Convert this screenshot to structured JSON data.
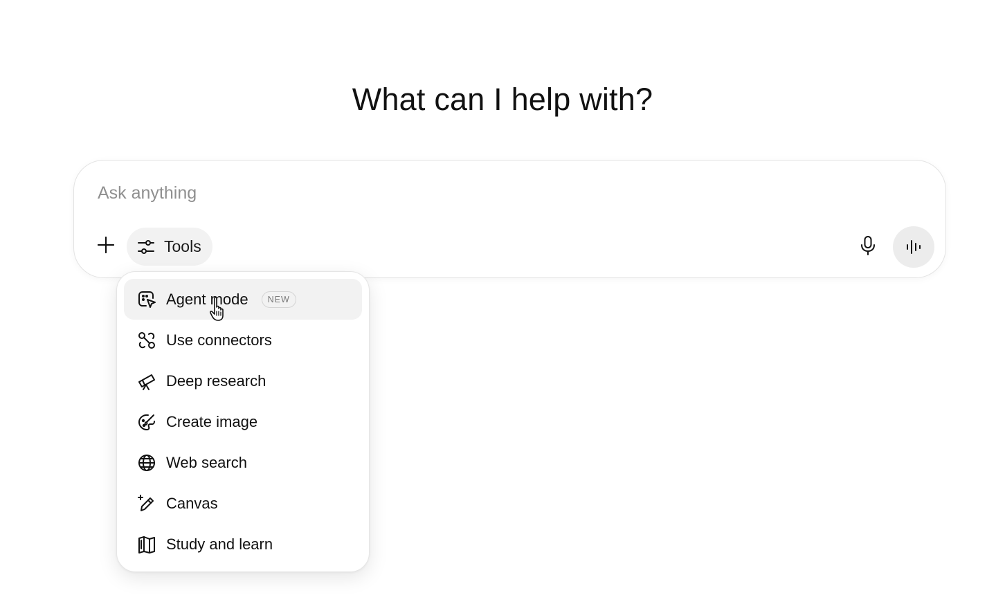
{
  "heading": "What can I help with?",
  "composer": {
    "placeholder": "Ask anything",
    "value": "",
    "tools_label": "Tools",
    "icons": {
      "add": "plus-icon",
      "tools": "sliders-icon",
      "mic": "microphone-icon",
      "voice": "voice-waveform-icon"
    }
  },
  "tools_menu": {
    "items": [
      {
        "label": "Agent mode",
        "icon": "agent-cursor-icon",
        "badge": "NEW",
        "hovered": true
      },
      {
        "label": "Use connectors",
        "icon": "connectors-icon"
      },
      {
        "label": "Deep research",
        "icon": "telescope-icon"
      },
      {
        "label": "Create image",
        "icon": "paint-palette-icon"
      },
      {
        "label": "Web search",
        "icon": "globe-icon"
      },
      {
        "label": "Canvas",
        "icon": "pencil-sparkle-icon"
      },
      {
        "label": "Study and learn",
        "icon": "book-icon"
      }
    ]
  },
  "colors": {
    "text": "#0d0d0d",
    "placeholder": "#8f8f8f",
    "chip_bg": "#f2f2f2",
    "border": "#e3e3e3"
  }
}
